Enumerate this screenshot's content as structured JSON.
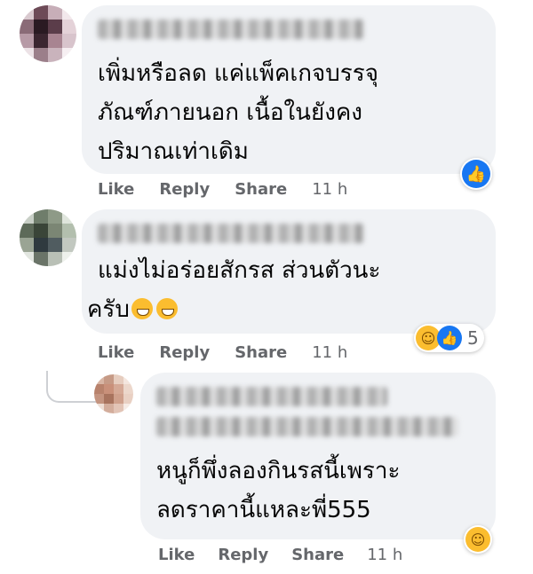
{
  "comments": [
    {
      "text_lines": [
        "เพิ่มหรือลด แค่แพ็คเกจบรรจุ",
        "ภัณฑ์ภายนอก เนื้อในยังคง",
        "ปริมาณเท่าเดิม"
      ],
      "actions": {
        "like": "Like",
        "reply": "Reply",
        "share": "Share",
        "time": "11 h"
      },
      "reactions": [
        "like-icon"
      ]
    },
    {
      "text_lines": [
        "แม่งไม่อร่อยสักรส ส่วนตัวนะ",
        "ครับ"
      ],
      "actions": {
        "like": "Like",
        "reply": "Reply",
        "share": "Share",
        "time": "11 h"
      },
      "reactions": [
        "haha-icon",
        "like-icon"
      ],
      "reaction_count": "5",
      "emojis": [
        "grinning-face-icon",
        "grinning-face-icon"
      ]
    }
  ],
  "reply": {
    "text_lines": [
      "หนูก็พึ่งลองกินรสนี้เพราะ",
      "ลดราคานี้แหละพี่555"
    ],
    "actions": {
      "like": "Like",
      "reply": "Reply",
      "share": "Share",
      "time": "11 h"
    },
    "reactions": [
      "haha-icon"
    ]
  },
  "colors": {
    "bubble": "#f0f2f5",
    "like_blue": "#1877f2",
    "haha_yellow": "#fbbd2f",
    "meta_gray": "#65676b"
  }
}
